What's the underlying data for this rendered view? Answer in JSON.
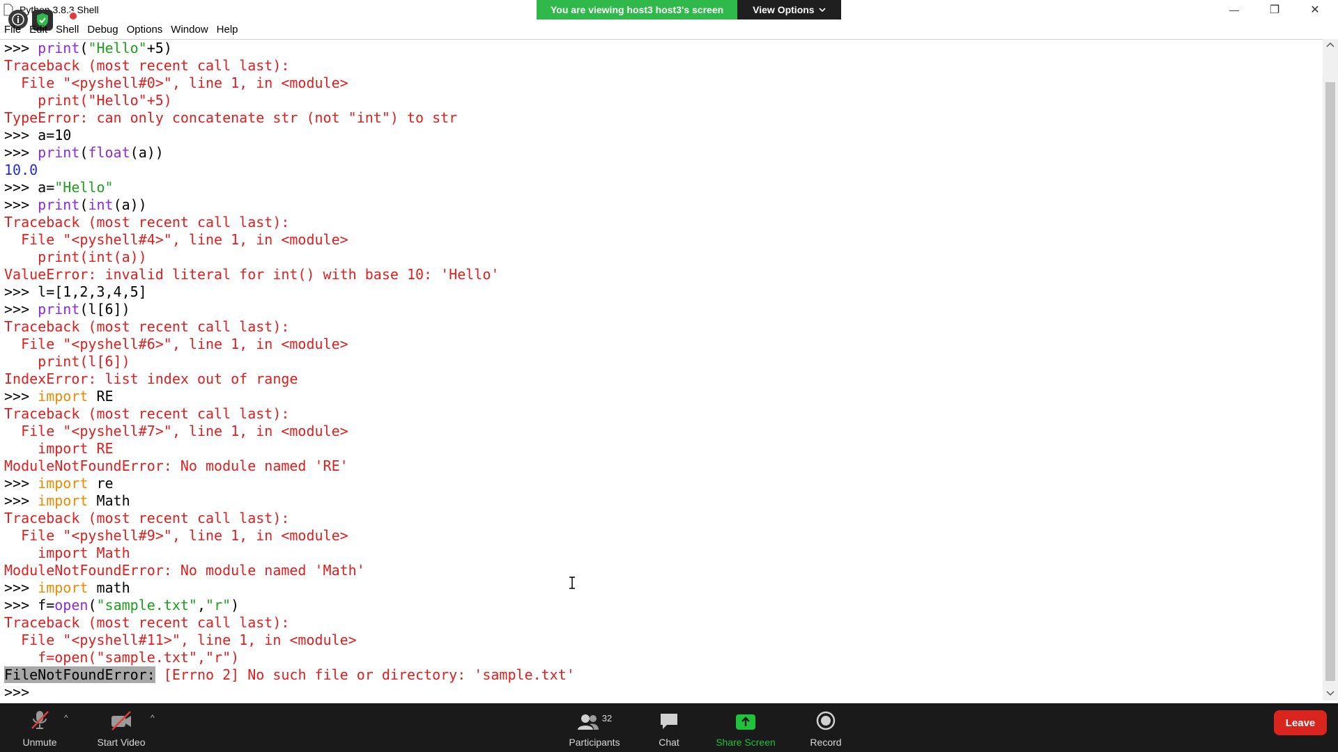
{
  "window": {
    "title": "Python 3.8.3 Shell",
    "minimize_glyph": "—",
    "maximize_glyph": "❐",
    "close_glyph": "✕"
  },
  "zoom_banner": {
    "viewing_text": "You are viewing host3 host3's screen",
    "view_options_label": "View Options"
  },
  "menu": {
    "items": [
      {
        "label": "File"
      },
      {
        "label": "Edit"
      },
      {
        "label": "Shell"
      },
      {
        "label": "Debug"
      },
      {
        "label": "Options"
      },
      {
        "label": "Window"
      },
      {
        "label": "Help"
      }
    ]
  },
  "shell": {
    "lines": [
      [
        {
          "t": ">>> ",
          "c": "p"
        },
        {
          "t": "print",
          "c": "bi"
        },
        {
          "t": "(",
          "c": "p"
        },
        {
          "t": "\"Hello\"",
          "c": "st"
        },
        {
          "t": "+5)",
          "c": "p"
        }
      ],
      [
        {
          "t": "Traceback (most recent call last):",
          "c": "err"
        }
      ],
      [
        {
          "t": "  File \"<pyshell#0>\", line 1, in <module>",
          "c": "err"
        }
      ],
      [
        {
          "t": "    print(\"Hello\"+5)",
          "c": "err"
        }
      ],
      [
        {
          "t": "TypeError: can only concatenate str (not \"int\") to str",
          "c": "err"
        }
      ],
      [
        {
          "t": ">>> ",
          "c": "p"
        },
        {
          "t": "a=10",
          "c": "p"
        }
      ],
      [
        {
          "t": ">>> ",
          "c": "p"
        },
        {
          "t": "print",
          "c": "bi"
        },
        {
          "t": "(",
          "c": "p"
        },
        {
          "t": "float",
          "c": "bi"
        },
        {
          "t": "(a))",
          "c": "p"
        }
      ],
      [
        {
          "t": "10.0",
          "c": "out"
        }
      ],
      [
        {
          "t": ">>> ",
          "c": "p"
        },
        {
          "t": "a=",
          "c": "p"
        },
        {
          "t": "\"Hello\"",
          "c": "st"
        }
      ],
      [
        {
          "t": ">>> ",
          "c": "p"
        },
        {
          "t": "print",
          "c": "bi"
        },
        {
          "t": "(",
          "c": "p"
        },
        {
          "t": "int",
          "c": "bi"
        },
        {
          "t": "(a))",
          "c": "p"
        }
      ],
      [
        {
          "t": "Traceback (most recent call last):",
          "c": "err"
        }
      ],
      [
        {
          "t": "  File \"<pyshell#4>\", line 1, in <module>",
          "c": "err"
        }
      ],
      [
        {
          "t": "    print(int(a))",
          "c": "err"
        }
      ],
      [
        {
          "t": "ValueError: invalid literal for int() with base 10: 'Hello'",
          "c": "err"
        }
      ],
      [
        {
          "t": ">>> ",
          "c": "p"
        },
        {
          "t": "l=[1,2,3,4,5]",
          "c": "p"
        }
      ],
      [
        {
          "t": ">>> ",
          "c": "p"
        },
        {
          "t": "print",
          "c": "bi"
        },
        {
          "t": "(l[6])",
          "c": "p"
        }
      ],
      [
        {
          "t": "Traceback (most recent call last):",
          "c": "err"
        }
      ],
      [
        {
          "t": "  File \"<pyshell#6>\", line 1, in <module>",
          "c": "err"
        }
      ],
      [
        {
          "t": "    print(l[6])",
          "c": "err"
        }
      ],
      [
        {
          "t": "IndexError: list index out of range",
          "c": "err"
        }
      ],
      [
        {
          "t": ">>> ",
          "c": "p"
        },
        {
          "t": "import",
          "c": "kw"
        },
        {
          "t": " RE",
          "c": "p"
        }
      ],
      [
        {
          "t": "Traceback (most recent call last):",
          "c": "err"
        }
      ],
      [
        {
          "t": "  File \"<pyshell#7>\", line 1, in <module>",
          "c": "err"
        }
      ],
      [
        {
          "t": "    import RE",
          "c": "err"
        }
      ],
      [
        {
          "t": "ModuleNotFoundError: No module named 'RE'",
          "c": "err"
        }
      ],
      [
        {
          "t": ">>> ",
          "c": "p"
        },
        {
          "t": "import",
          "c": "kw"
        },
        {
          "t": " re",
          "c": "p"
        }
      ],
      [
        {
          "t": ">>> ",
          "c": "p"
        },
        {
          "t": "import",
          "c": "kw"
        },
        {
          "t": " Math",
          "c": "p"
        }
      ],
      [
        {
          "t": "Traceback (most recent call last):",
          "c": "err"
        }
      ],
      [
        {
          "t": "  File \"<pyshell#9>\", line 1, in <module>",
          "c": "err"
        }
      ],
      [
        {
          "t": "    import Math",
          "c": "err"
        }
      ],
      [
        {
          "t": "ModuleNotFoundError: No module named 'Math'",
          "c": "err"
        }
      ],
      [
        {
          "t": ">>> ",
          "c": "p"
        },
        {
          "t": "import",
          "c": "kw"
        },
        {
          "t": " math",
          "c": "p"
        }
      ],
      [
        {
          "t": ">>> ",
          "c": "p"
        },
        {
          "t": "f=",
          "c": "p"
        },
        {
          "t": "open",
          "c": "bi"
        },
        {
          "t": "(",
          "c": "p"
        },
        {
          "t": "\"sample.txt\"",
          "c": "st"
        },
        {
          "t": ",",
          "c": "p"
        },
        {
          "t": "\"r\"",
          "c": "st"
        },
        {
          "t": ")",
          "c": "p"
        }
      ],
      [
        {
          "t": "Traceback (most recent call last):",
          "c": "err"
        }
      ],
      [
        {
          "t": "  File \"<pyshell#11>\", line 1, in <module>",
          "c": "err"
        }
      ],
      [
        {
          "t": "    f=open(\"sample.txt\",\"r\")",
          "c": "err"
        }
      ],
      [
        {
          "t": "FileNotFoundError:",
          "c": "hl"
        },
        {
          "t": " [Errno 2] No such file or directory: 'sample.txt'",
          "c": "err"
        }
      ],
      [
        {
          "t": ">>> ",
          "c": "p"
        }
      ]
    ]
  },
  "toolbar": {
    "unmute_label": "Unmute",
    "start_video_label": "Start Video",
    "participants_label": "Participants",
    "participants_count": "32",
    "chat_label": "Chat",
    "share_screen_label": "Share Screen",
    "record_label": "Record",
    "leave_label": "Leave"
  },
  "colors": {
    "banner_green": "#2fb94a",
    "error_red": "#e01e1e",
    "output_blue": "#1f2cd6",
    "keyword_orange": "#ef8a00",
    "builtin_purple": "#8a2be2",
    "string_green": "#1aa11a",
    "share_green": "#1fc23a",
    "leave_red": "#d9251d"
  }
}
